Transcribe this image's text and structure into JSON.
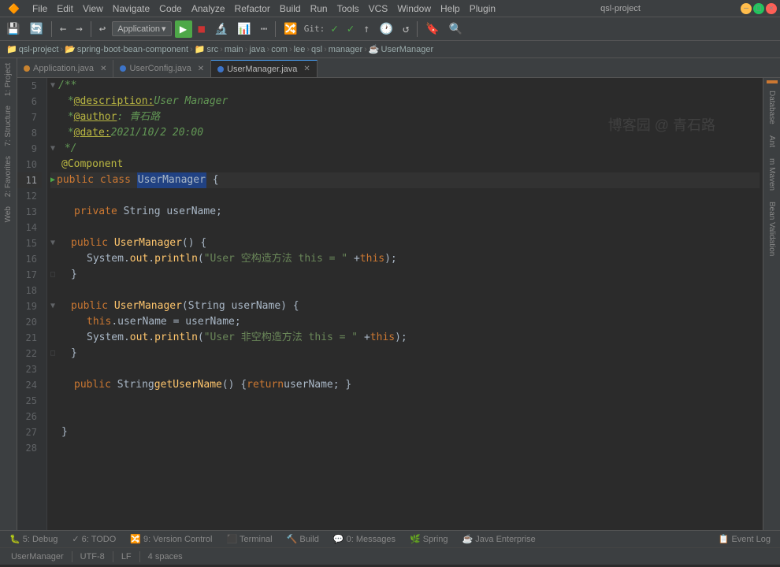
{
  "window": {
    "title": "qsl-project",
    "min": "—",
    "max": "□",
    "close": "✕"
  },
  "menubar": {
    "items": [
      "File",
      "Edit",
      "View",
      "Navigate",
      "Code",
      "Analyze",
      "Refactor",
      "Build",
      "Run",
      "Tools",
      "VCS",
      "Window",
      "Help",
      "Plugin"
    ]
  },
  "toolbar": {
    "app_label": "Application",
    "git_label": "Git:",
    "run_icon": "▶",
    "debug_icon": "🐛"
  },
  "breadcrumb": {
    "project": "qsl-project",
    "folder1": "spring-boot-bean-component",
    "folder2": "src",
    "folder3": "main",
    "folder4": "java",
    "folder5": "com",
    "folder6": "lee",
    "folder7": "qsl",
    "folder8": "manager",
    "file": "UserManager"
  },
  "tabs": [
    {
      "label": "Application.java",
      "type": "orange",
      "active": false
    },
    {
      "label": "UserConfig.java",
      "type": "blue",
      "active": false
    },
    {
      "label": "UserManager.java",
      "type": "blue",
      "active": true
    }
  ],
  "code": {
    "lines": [
      {
        "num": 5,
        "fold": true,
        "content": "/**"
      },
      {
        "num": 6,
        "content": " * @description: User Manager"
      },
      {
        "num": 7,
        "content": " * @author : 青石路"
      },
      {
        "num": 8,
        "content": " * @date: 2021/10/2 20:00"
      },
      {
        "num": 9,
        "fold": true,
        "content": " */"
      },
      {
        "num": 10,
        "content": "@Component"
      },
      {
        "num": 11,
        "gutter": true,
        "content": "public class UserManager {",
        "active": true
      },
      {
        "num": 12,
        "content": ""
      },
      {
        "num": 13,
        "content": "    private String userName;"
      },
      {
        "num": 14,
        "content": ""
      },
      {
        "num": 15,
        "fold": true,
        "content": "    public UserManager() {"
      },
      {
        "num": 16,
        "content": "        System.out.println(\"User 空构造方法 this = \" + this);"
      },
      {
        "num": 17,
        "fold_end": true,
        "content": "    }"
      },
      {
        "num": 18,
        "content": ""
      },
      {
        "num": 19,
        "fold": true,
        "content": "    public UserManager(String userName) {"
      },
      {
        "num": 20,
        "content": "        this.userName = userName;"
      },
      {
        "num": 21,
        "content": "        System.out.println(\"User 非空构造方法 this = \" + this);"
      },
      {
        "num": 22,
        "fold_end": true,
        "content": "    }"
      },
      {
        "num": 23,
        "content": ""
      },
      {
        "num": 24,
        "content": "    public String getUserName() { return userName; }"
      },
      {
        "num": 25,
        "content": ""
      },
      {
        "num": 26,
        "content": ""
      },
      {
        "num": 27,
        "content": "}"
      },
      {
        "num": 28,
        "content": ""
      }
    ],
    "watermark": "博客园 @ 青石路"
  },
  "right_panels": {
    "items": [
      "Database",
      "Ant",
      "m Maven",
      "Bean Validation"
    ]
  },
  "bottom_tabs": {
    "items": [
      "5: Debug",
      "6: TODO",
      "9: Version Control",
      "Terminal",
      "Build",
      "0: Messages",
      "Spring",
      "Java Enterprise",
      "Event Log"
    ]
  },
  "statusbar": {
    "item": "UserManager",
    "line_col": ""
  }
}
